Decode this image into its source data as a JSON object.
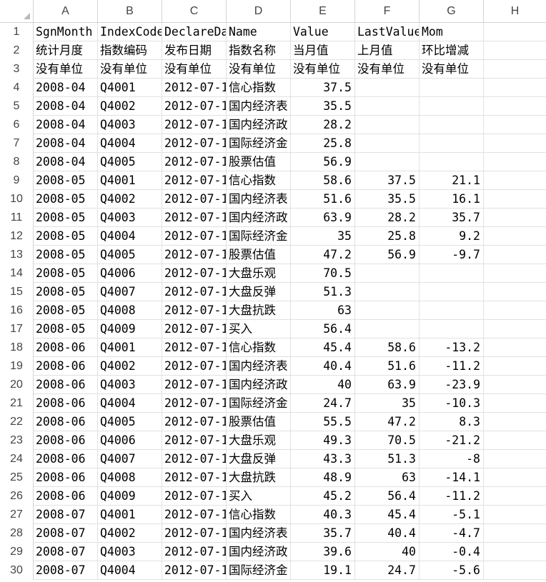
{
  "columns": [
    "A",
    "B",
    "C",
    "D",
    "E",
    "F",
    "G",
    "H"
  ],
  "rows": [
    {
      "num": "1",
      "cells": [
        "SgnMonth",
        "IndexCode",
        "DeclareDate",
        "Name",
        "Value",
        "LastValue",
        "Mom",
        ""
      ]
    },
    {
      "num": "2",
      "cells": [
        "统计月度",
        "指数编码",
        "发布日期",
        "指数名称",
        "当月值",
        "上月值",
        "环比增减",
        ""
      ]
    },
    {
      "num": "3",
      "cells": [
        "没有单位",
        "没有单位",
        "没有单位",
        "没有单位",
        "没有单位",
        "没有单位",
        "没有单位",
        ""
      ]
    },
    {
      "num": "4",
      "cells": [
        "2008-04",
        "Q4001",
        "2012-07-1",
        "信心指数",
        "37.5",
        "",
        "",
        ""
      ]
    },
    {
      "num": "5",
      "cells": [
        "2008-04",
        "Q4002",
        "2012-07-1",
        "国内经济表",
        "35.5",
        "",
        "",
        ""
      ]
    },
    {
      "num": "6",
      "cells": [
        "2008-04",
        "Q4003",
        "2012-07-1",
        "国内经济政",
        "28.2",
        "",
        "",
        ""
      ]
    },
    {
      "num": "7",
      "cells": [
        "2008-04",
        "Q4004",
        "2012-07-1",
        "国际经济金",
        "25.8",
        "",
        "",
        ""
      ]
    },
    {
      "num": "8",
      "cells": [
        "2008-04",
        "Q4005",
        "2012-07-1",
        "股票估值",
        "56.9",
        "",
        "",
        ""
      ]
    },
    {
      "num": "9",
      "cells": [
        "2008-05",
        "Q4001",
        "2012-07-1",
        "信心指数",
        "58.6",
        "37.5",
        "21.1",
        ""
      ]
    },
    {
      "num": "10",
      "cells": [
        "2008-05",
        "Q4002",
        "2012-07-1",
        "国内经济表",
        "51.6",
        "35.5",
        "16.1",
        ""
      ]
    },
    {
      "num": "11",
      "cells": [
        "2008-05",
        "Q4003",
        "2012-07-1",
        "国内经济政",
        "63.9",
        "28.2",
        "35.7",
        ""
      ]
    },
    {
      "num": "12",
      "cells": [
        "2008-05",
        "Q4004",
        "2012-07-1",
        "国际经济金",
        "35",
        "25.8",
        "9.2",
        ""
      ]
    },
    {
      "num": "13",
      "cells": [
        "2008-05",
        "Q4005",
        "2012-07-1",
        "股票估值",
        "47.2",
        "56.9",
        "-9.7",
        ""
      ]
    },
    {
      "num": "14",
      "cells": [
        "2008-05",
        "Q4006",
        "2012-07-1",
        "大盘乐观",
        "70.5",
        "",
        "",
        ""
      ]
    },
    {
      "num": "15",
      "cells": [
        "2008-05",
        "Q4007",
        "2012-07-1",
        "大盘反弹",
        "51.3",
        "",
        "",
        ""
      ]
    },
    {
      "num": "16",
      "cells": [
        "2008-05",
        "Q4008",
        "2012-07-1",
        "大盘抗跌",
        "63",
        "",
        "",
        ""
      ]
    },
    {
      "num": "17",
      "cells": [
        "2008-05",
        "Q4009",
        "2012-07-1",
        "买入",
        "56.4",
        "",
        "",
        ""
      ]
    },
    {
      "num": "18",
      "cells": [
        "2008-06",
        "Q4001",
        "2012-07-1",
        "信心指数",
        "45.4",
        "58.6",
        "-13.2",
        ""
      ]
    },
    {
      "num": "19",
      "cells": [
        "2008-06",
        "Q4002",
        "2012-07-1",
        "国内经济表",
        "40.4",
        "51.6",
        "-11.2",
        ""
      ]
    },
    {
      "num": "20",
      "cells": [
        "2008-06",
        "Q4003",
        "2012-07-1",
        "国内经济政",
        "40",
        "63.9",
        "-23.9",
        ""
      ]
    },
    {
      "num": "21",
      "cells": [
        "2008-06",
        "Q4004",
        "2012-07-1",
        "国际经济金",
        "24.7",
        "35",
        "-10.3",
        ""
      ]
    },
    {
      "num": "22",
      "cells": [
        "2008-06",
        "Q4005",
        "2012-07-1",
        "股票估值",
        "55.5",
        "47.2",
        "8.3",
        ""
      ]
    },
    {
      "num": "23",
      "cells": [
        "2008-06",
        "Q4006",
        "2012-07-1",
        "大盘乐观",
        "49.3",
        "70.5",
        "-21.2",
        ""
      ]
    },
    {
      "num": "24",
      "cells": [
        "2008-06",
        "Q4007",
        "2012-07-1",
        "大盘反弹",
        "43.3",
        "51.3",
        "-8",
        ""
      ]
    },
    {
      "num": "25",
      "cells": [
        "2008-06",
        "Q4008",
        "2012-07-1",
        "大盘抗跌",
        "48.9",
        "63",
        "-14.1",
        ""
      ]
    },
    {
      "num": "26",
      "cells": [
        "2008-06",
        "Q4009",
        "2012-07-1",
        "买入",
        "45.2",
        "56.4",
        "-11.2",
        ""
      ]
    },
    {
      "num": "27",
      "cells": [
        "2008-07",
        "Q4001",
        "2012-07-1",
        "信心指数",
        "40.3",
        "45.4",
        "-5.1",
        ""
      ]
    },
    {
      "num": "28",
      "cells": [
        "2008-07",
        "Q4002",
        "2012-07-1",
        "国内经济表",
        "35.7",
        "40.4",
        "-4.7",
        ""
      ]
    },
    {
      "num": "29",
      "cells": [
        "2008-07",
        "Q4003",
        "2012-07-1",
        "国内经济政",
        "39.6",
        "40",
        "-0.4",
        ""
      ]
    },
    {
      "num": "30",
      "cells": [
        "2008-07",
        "Q4004",
        "2012-07-1",
        "国际经济金",
        "19.1",
        "24.7",
        "-5.6",
        ""
      ]
    }
  ]
}
